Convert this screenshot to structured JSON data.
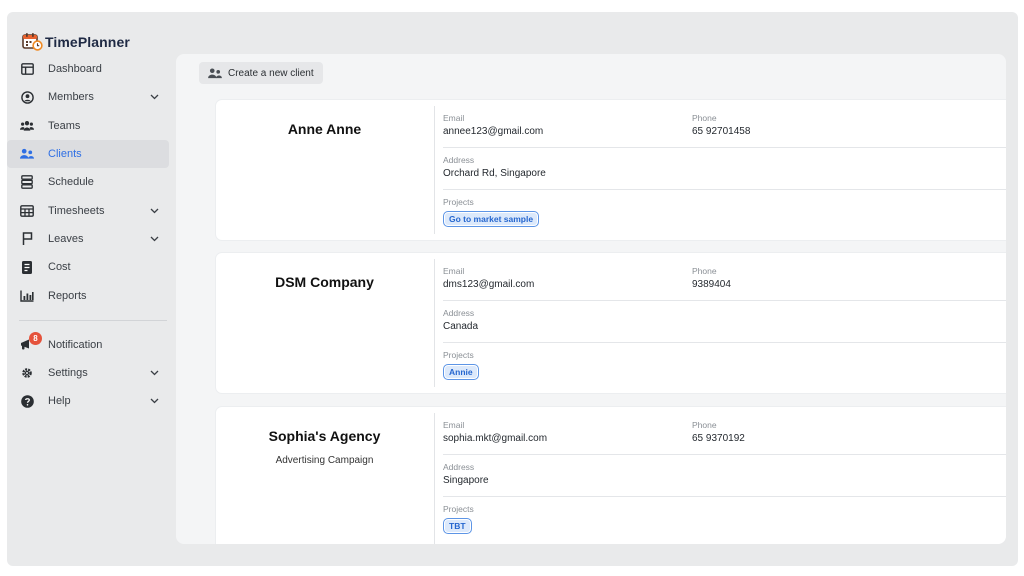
{
  "app": {
    "name": "TimePlanner"
  },
  "sidebar": {
    "items": [
      {
        "label": "Dashboard",
        "icon": "dashboard-icon",
        "has_chevron": false,
        "active": false
      },
      {
        "label": "Members",
        "icon": "members-icon",
        "has_chevron": true,
        "active": false
      },
      {
        "label": "Teams",
        "icon": "teams-icon",
        "has_chevron": false,
        "active": false
      },
      {
        "label": "Clients",
        "icon": "clients-icon",
        "has_chevron": false,
        "active": true
      },
      {
        "label": "Schedule",
        "icon": "schedule-icon",
        "has_chevron": false,
        "active": false
      },
      {
        "label": "Timesheets",
        "icon": "timesheets-icon",
        "has_chevron": true,
        "active": false
      },
      {
        "label": "Leaves",
        "icon": "flag-icon",
        "has_chevron": true,
        "active": false
      },
      {
        "label": "Cost",
        "icon": "cost-icon",
        "has_chevron": false,
        "active": false
      },
      {
        "label": "Reports",
        "icon": "reports-icon",
        "has_chevron": false,
        "active": false
      }
    ],
    "bottom_items": [
      {
        "label": "Notification",
        "icon": "megaphone-icon",
        "has_chevron": false,
        "badge": "8"
      },
      {
        "label": "Settings",
        "icon": "gear-icon",
        "has_chevron": true
      },
      {
        "label": "Help",
        "icon": "help-icon",
        "has_chevron": true
      }
    ]
  },
  "toolbar": {
    "create_label": "Create a new client"
  },
  "fields": {
    "email": "Email",
    "phone": "Phone",
    "address": "Address",
    "projects": "Projects"
  },
  "clients": [
    {
      "name": "Anne Anne",
      "subtitle": "",
      "email": "annee123@gmail.com",
      "phone": "65 92701458",
      "address": "Orchard Rd, Singapore",
      "projects": [
        "Go to market sample"
      ]
    },
    {
      "name": "DSM Company",
      "subtitle": "",
      "email": "dms123@gmail.com",
      "phone": "9389404",
      "address": "Canada",
      "projects": [
        "Annie"
      ]
    },
    {
      "name": "Sophia's Agency",
      "subtitle": "Advertising Campaign",
      "email": "sophia.mkt@gmail.com",
      "phone": "65 9370192",
      "address": "Singapore",
      "projects": [
        "TBT"
      ]
    }
  ],
  "colors": {
    "accent": "#2f6fe4",
    "badge": "#e5533c",
    "logo_orange": "#f08a24"
  }
}
